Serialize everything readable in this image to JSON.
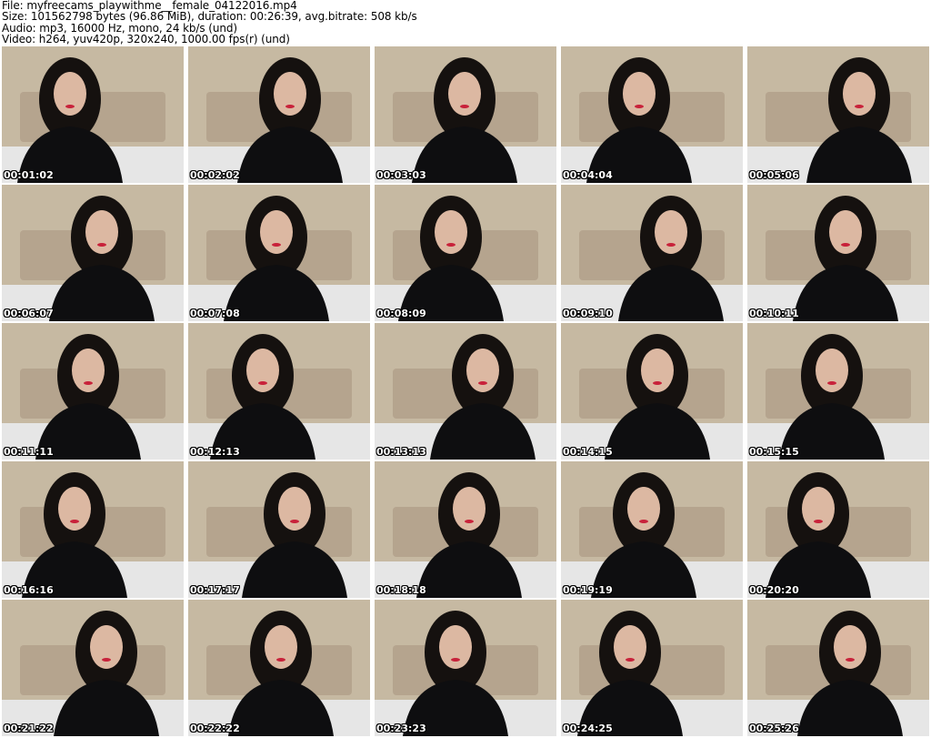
{
  "header": {
    "file_line": "File: myfreecams_playwithme__female_04122016.mp4",
    "size_line": "Size: 101562798 bytes (96.86 MiB), duration: 00:26:39, avg.bitrate: 508 kb/s",
    "audio_line": "Audio: mp3, 16000 Hz, mono, 24 kb/s (und)",
    "video_line": "Video: h264, yuv420p, 320x240, 1000.00 fps(r) (und)"
  },
  "thumbnails": [
    {
      "timestamp": "00:01:02"
    },
    {
      "timestamp": "00:02:02"
    },
    {
      "timestamp": "00:03:03"
    },
    {
      "timestamp": "00:04:04"
    },
    {
      "timestamp": "00:05:06"
    },
    {
      "timestamp": "00:06:07"
    },
    {
      "timestamp": "00:07:08"
    },
    {
      "timestamp": "00:08:09"
    },
    {
      "timestamp": "00:09:10"
    },
    {
      "timestamp": "00:10:11"
    },
    {
      "timestamp": "00:11:11"
    },
    {
      "timestamp": "00:12:13"
    },
    {
      "timestamp": "00:13:13"
    },
    {
      "timestamp": "00:14:15"
    },
    {
      "timestamp": "00:15:15"
    },
    {
      "timestamp": "00:16:16"
    },
    {
      "timestamp": "00:17:17"
    },
    {
      "timestamp": "00:18:18"
    },
    {
      "timestamp": "00:19:19"
    },
    {
      "timestamp": "00:20:20"
    },
    {
      "timestamp": "00:21:22"
    },
    {
      "timestamp": "00:22:22"
    },
    {
      "timestamp": "00:23:23"
    },
    {
      "timestamp": "00:24:25"
    },
    {
      "timestamp": "00:25:26"
    }
  ]
}
